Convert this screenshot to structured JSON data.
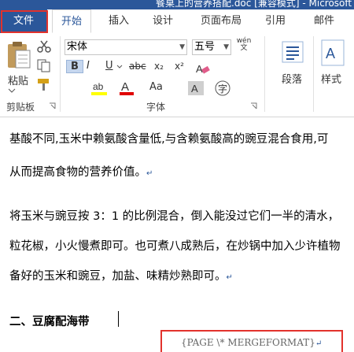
{
  "window": {
    "title": "餐桌上的营养搭配.doc [兼容模式] - Microsoft"
  },
  "tabs": [
    "文件",
    "开始",
    "插入",
    "设计",
    "页面布局",
    "引用",
    "邮件"
  ],
  "ribbon": {
    "clipboard": {
      "paste_label": "粘贴",
      "group_label": "剪贴板"
    },
    "font": {
      "font_name": "宋体",
      "font_size": "五号",
      "pinyin_label": "wén\n文",
      "bold": "B",
      "italic": "I",
      "underline": "U",
      "strike": "abc",
      "subscript": "x₂",
      "superscript": "x²",
      "font_color": "A",
      "change_case": "Aa",
      "group_label": "字体"
    },
    "paragraph": {
      "label": "段落"
    },
    "styles": {
      "label": "样式"
    }
  },
  "document": {
    "lines": [
      "基酸不同,玉米中赖氨酸含量低,与含赖氨酸高的豌豆混合食用,可",
      "从而提高食物的营养价值。",
      "将玉米与豌豆按 3：1 的比例混合，倒入能没过它们一半的清水，",
      "粒花椒，小火慢煮即可。也可煮八成熟后，在炒锅中加入少许植物",
      "备好的玉米和豌豆，加盐、味精炒熟即可。",
      "二、豆腐配海带"
    ],
    "footer_field": "{PAGE     \\* MERGEFORMAT}"
  },
  "colors": {
    "accent": "#2b579a",
    "highlight_box": "#e2322c"
  }
}
